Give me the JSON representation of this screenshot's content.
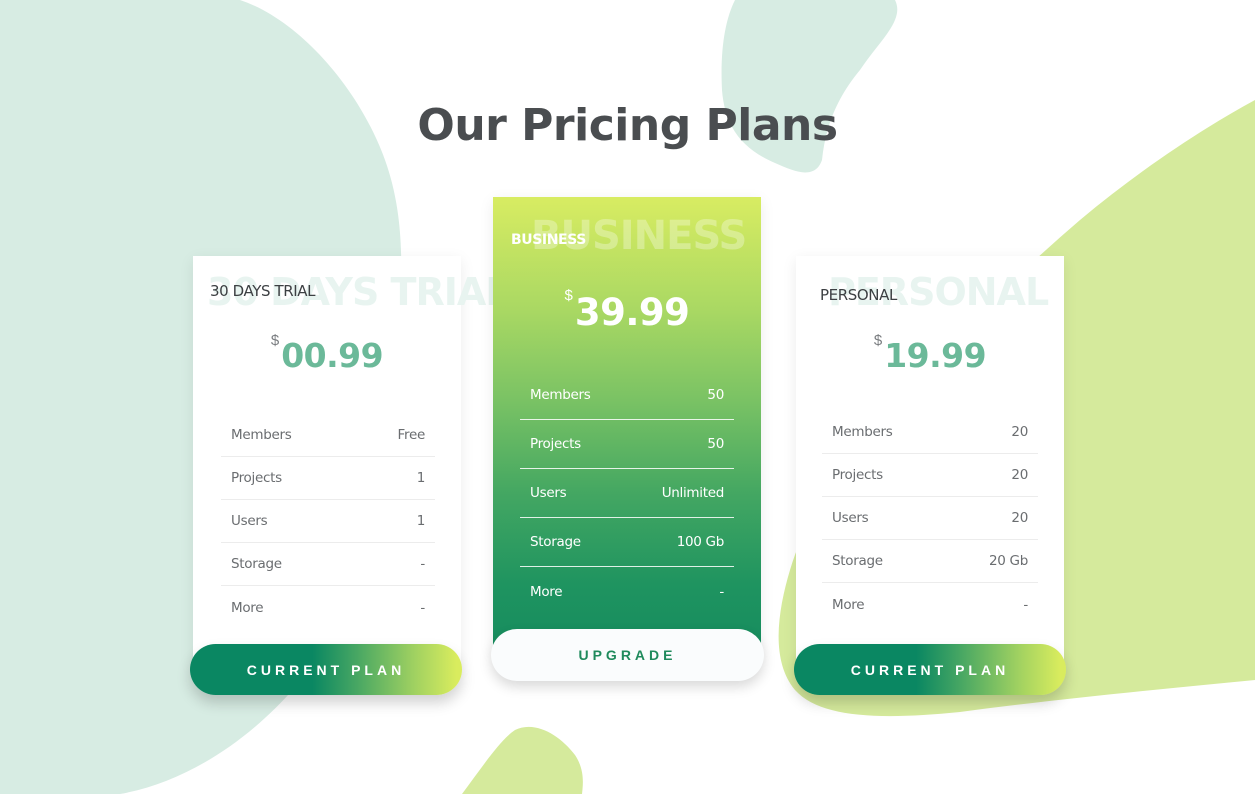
{
  "page": {
    "title_parts": [
      {
        "cap": "O",
        "rest": "ur "
      },
      {
        "cap": "P",
        "rest": "ricing "
      },
      {
        "cap": "P",
        "rest": "lans"
      }
    ]
  },
  "colors": {
    "accent_green": "#0a8762",
    "accent_lime": "#d9ec5e",
    "price_green": "#6bb999",
    "bg_mint": "#d7ece3",
    "bg_lime": "#d5ea9c",
    "title_gray": "#4a4d50"
  },
  "plans": [
    {
      "id": "trial",
      "name": "30 DAYS TRIAL",
      "ghost_name": "30 DAYS TRIAL",
      "currency": "$",
      "price": "00.99",
      "features": [
        {
          "label": "Members",
          "value": "Free"
        },
        {
          "label": "Projects",
          "value": "1"
        },
        {
          "label": "Users",
          "value": "1"
        },
        {
          "label": "Storage",
          "value": "-"
        },
        {
          "label": "More",
          "value": "-"
        }
      ],
      "button_label": "CURRENT PLAN"
    },
    {
      "id": "business",
      "name": "BUSINESS",
      "ghost_name": "BUSINESS",
      "currency": "$",
      "price": "39.99",
      "features": [
        {
          "label": "Members",
          "value": "50"
        },
        {
          "label": "Projects",
          "value": "50"
        },
        {
          "label": "Users",
          "value": "Unlimited"
        },
        {
          "label": "Storage",
          "value": "100 Gb"
        },
        {
          "label": "More",
          "value": "-"
        }
      ],
      "button_label": "UPGRADE"
    },
    {
      "id": "personal",
      "name": "PERSONAL",
      "ghost_name": "PERSONAL",
      "currency": "$",
      "price": "19.99",
      "features": [
        {
          "label": "Members",
          "value": "20"
        },
        {
          "label": "Projects",
          "value": "20"
        },
        {
          "label": "Users",
          "value": "20"
        },
        {
          "label": "Storage",
          "value": "20 Gb"
        },
        {
          "label": "More",
          "value": "-"
        }
      ],
      "button_label": "CURRENT PLAN"
    }
  ]
}
